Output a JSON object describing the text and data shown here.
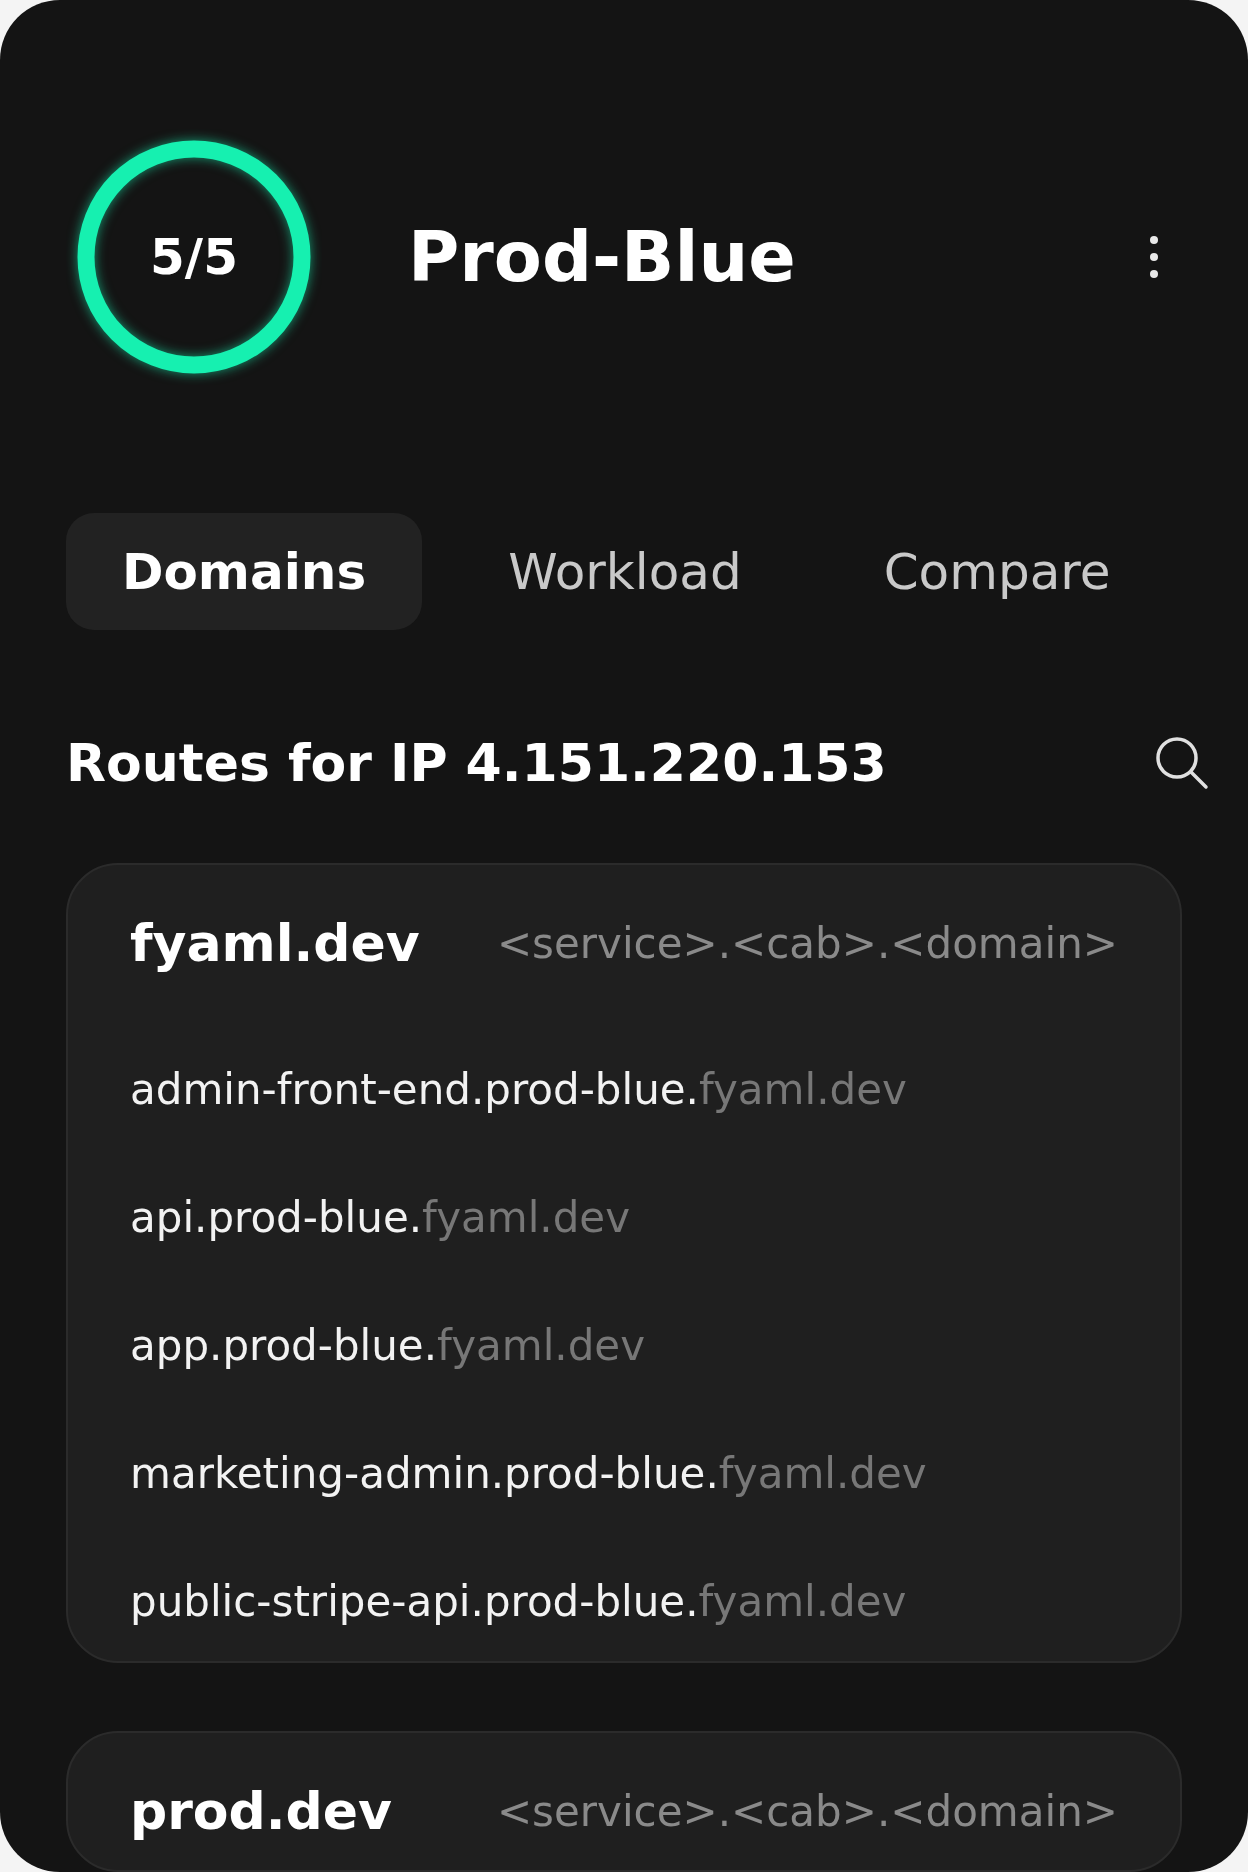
{
  "header": {
    "score": "5/5",
    "title": "Prod-Blue"
  },
  "tabs": [
    {
      "label": "Domains",
      "selected": true
    },
    {
      "label": "Workload",
      "selected": false
    },
    {
      "label": "Compare",
      "selected": false
    }
  ],
  "section": {
    "title": "Routes for IP 4.151.220.153"
  },
  "domains": [
    {
      "name": "fyaml.dev",
      "pattern": "<service>.<cab>.<domain>",
      "routes": [
        {
          "prefix": "admin-front-end.prod-blue.",
          "suffix": "fyaml.dev"
        },
        {
          "prefix": "api.prod-blue.",
          "suffix": "fyaml.dev"
        },
        {
          "prefix": "app.prod-blue.",
          "suffix": "fyaml.dev"
        },
        {
          "prefix": "marketing-admin.prod-blue.",
          "suffix": "fyaml.dev"
        },
        {
          "prefix": "public-stripe-api.prod-blue.",
          "suffix": "fyaml.dev"
        }
      ]
    },
    {
      "name": "prod.dev",
      "pattern": "<service>.<cab>.<domain>"
    }
  ]
}
